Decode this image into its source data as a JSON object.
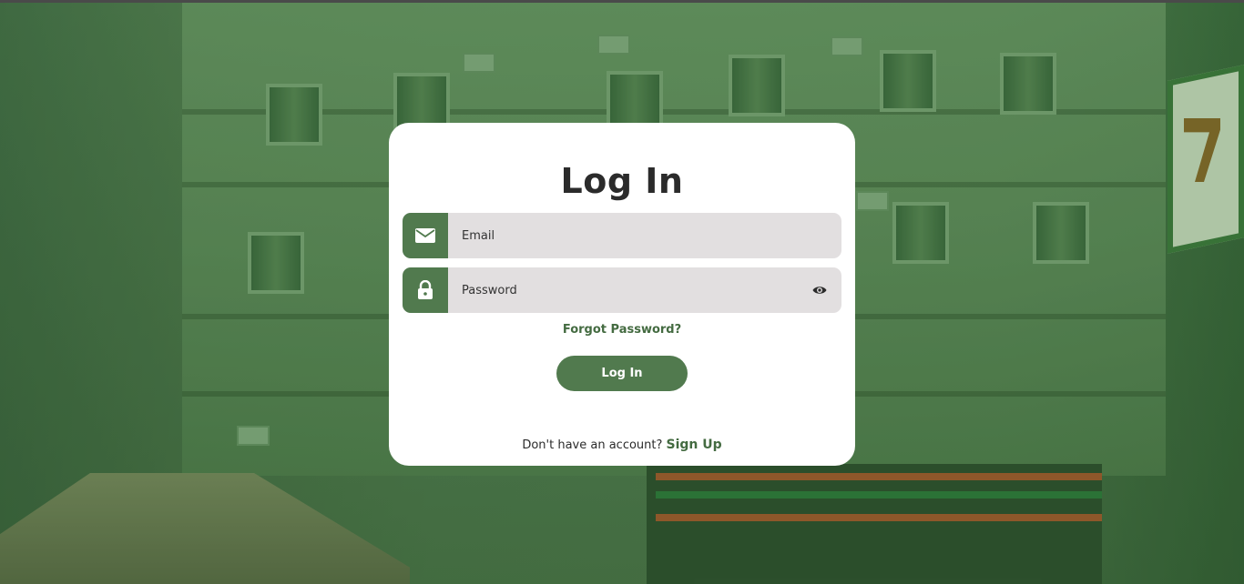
{
  "login": {
    "title": "Log In",
    "email": {
      "placeholder": "Email",
      "value": "",
      "icon": "mail-icon"
    },
    "password": {
      "placeholder": "Password",
      "value": "",
      "icon": "lock-icon",
      "toggle_icon": "eye-icon"
    },
    "forgot_label": "Forgot Password?",
    "submit_label": "Log In",
    "signup_prompt": "Don't have an account?",
    "signup_label": "Sign Up"
  },
  "colors": {
    "accent": "#517a4e",
    "link": "#446b41",
    "field_bg": "#e2dfe0",
    "card_bg": "#ffffff",
    "title": "#2b2b2b"
  }
}
